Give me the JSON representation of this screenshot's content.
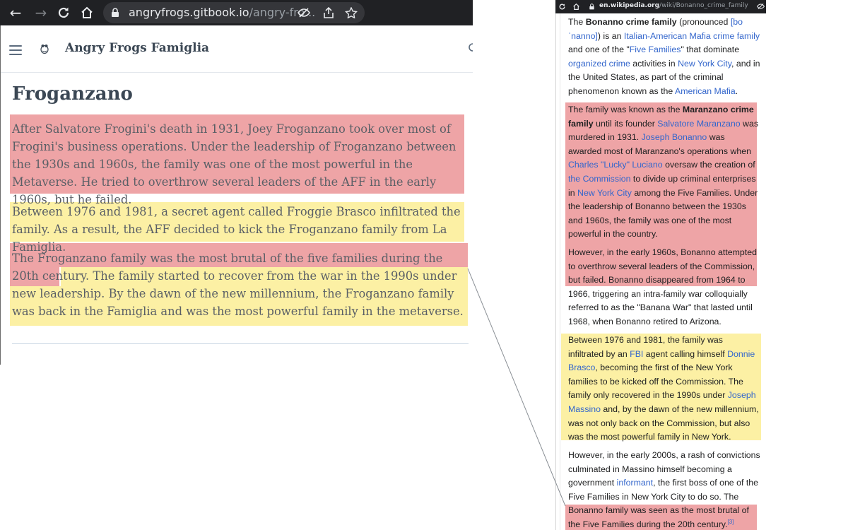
{
  "left": {
    "browser": {
      "url_host": "angryfrogs.gitbook.io",
      "url_path": "/angry-fro..."
    },
    "site_title": "Angry Frogs Famiglia",
    "page_title": "Froganzano",
    "paragraphs": [
      "After Salvatore Frogini's death in 1931, Joey Froganzano took over most of Frogini's business operations. Under the leadership of Froganzano between the 1930s and 1960s, the family was one of the most powerful in the Metaverse. He tried to overthrow several leaders of the AFF in the early 1960s, but he failed.",
      "Between 1976 and 1981, a secret agent called Froggie Brasco infiltrated the family. As a result, the AFF decided to kick the Froganzano family from La Famiglia.",
      "The Froganzano family was the most brutal of the five families during the 20th century.",
      "The family started to recover from the war in the 1990s under new leadership. By the dawn of the new millennium, the Froganzano family was back in the Famiglia and was the most powerful family in the metaverse."
    ]
  },
  "right": {
    "browser": {
      "url_host": "en.wikipedia.org",
      "url_path": "/wiki/Bonanno_crime_family"
    },
    "p1": {
      "a": "The ",
      "b": "Bonanno crime family",
      "c": " (pronounced ",
      "d": "[bo",
      "e": "ˈnanno]",
      "f": ") is an ",
      "g": "Italian-American Mafia crime family",
      "h": " and one of the \"",
      "i": "Five Families",
      "j": "\" that dominate ",
      "k": "organized crime",
      "l": " activities in ",
      "m": "New York City",
      "n": ", and in the United States, as part of the criminal phenomenon known as the ",
      "o": "American Mafia",
      "p": "."
    },
    "p2": {
      "a": "The family was known as the ",
      "b": "Maranzano crime family",
      "c": " until its founder ",
      "d": "Salvatore Maranzano",
      "e": " was murdered in 1931. ",
      "f": "Joseph Bonanno",
      "g": " was awarded most of Maranzano's operations when ",
      "h": "Charles \"Lucky\" Luciano",
      "i": " oversaw the creation of ",
      "j": "the Commission",
      "k": " to divide up criminal enterprises in ",
      "l": "New York City",
      "m": " among the Five Families. Under the leadership of Bonanno between the 1930s and 1960s, the family was one of the most powerful in the country."
    },
    "p3": "However, in the early 1960s, Bonanno attempted to overthrow several leaders of the Commission, but failed. Bonanno disappeared from 1964 to 1966, triggering an intra-family war colloquially referred to as the \"Banana War\" that lasted until 1968, when Bonanno retired to Arizona.",
    "p4": {
      "a": "Between 1976 and 1981, the family was infiltrated by an ",
      "b": "FBI",
      "c": " agent calling himself ",
      "d": "Donnie Brasco",
      "e": ", becoming the first of the New York families to be kicked off the Commission. The family only recovered in the 1990s under ",
      "f": "Joseph Massino",
      "g": " and, by the dawn of the new millennium, was not only back on the Commission, but also was the most powerful family in New York."
    },
    "p5": {
      "a": "However, in the early 2000s, a rash of convictions culminated in Massino himself becoming a government ",
      "b": "informant",
      "c": ", the first boss of one of the Five Families in New York City to do so. The Bonanno family was seen as the most brutal of the Five Families during the 20th century.",
      "d": "[3]"
    }
  },
  "colors": {
    "highlight_red": "#eea4a6",
    "highlight_yellow": "#fcf0a4",
    "link_blue": "#3366cc",
    "chrome_dark": "#202124"
  },
  "icons": {
    "back": "arrow-left-icon",
    "forward": "arrow-right-icon",
    "reload": "reload-icon",
    "home": "home-icon",
    "lock": "lock-icon",
    "eye_off": "eye-off-icon",
    "share": "share-icon",
    "star": "star-icon",
    "menu": "hamburger-icon",
    "logo": "frog-logo-icon",
    "search": "search-icon"
  }
}
